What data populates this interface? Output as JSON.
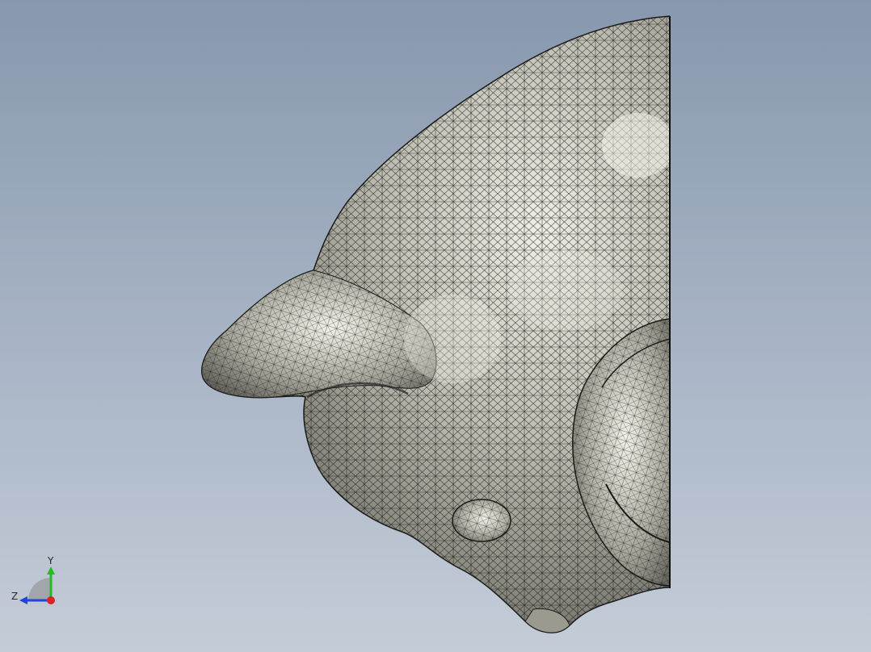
{
  "viewport": {
    "model_name": "mesh-head-half-section",
    "background_top": "#8797ad",
    "background_bottom": "#c4ccd7",
    "mesh_fill": "#b9b9ad",
    "mesh_line": "#141414"
  },
  "triad": {
    "y_label": "Y",
    "z_label": "Z",
    "y_color": "#22bb22",
    "z_color": "#2244dd",
    "x_color": "#dd2222"
  }
}
